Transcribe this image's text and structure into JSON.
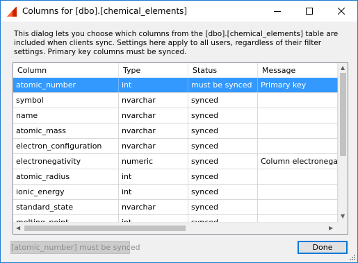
{
  "window": {
    "title": "Columns for [dbo].[chemical_elements]",
    "icon": "app-logo-icon"
  },
  "description": "This dialog lets you choose which columns from the [dbo].[chemical_elements] table are included when clients sync. Settings here apply to all users, regardless of their filter settings. Primary key columns must be synced.",
  "grid": {
    "headers": [
      "Column",
      "Type",
      "Status",
      "Message"
    ],
    "rows": [
      {
        "column": "atomic_number",
        "type": "int",
        "status": "must be synced",
        "message": "Primary key"
      },
      {
        "column": "symbol",
        "type": "nvarchar",
        "status": "synced",
        "message": ""
      },
      {
        "column": "name",
        "type": "nvarchar",
        "status": "synced",
        "message": ""
      },
      {
        "column": "atomic_mass",
        "type": "nvarchar",
        "status": "synced",
        "message": ""
      },
      {
        "column": "electron_configuration",
        "type": "nvarchar",
        "status": "synced",
        "message": ""
      },
      {
        "column": "electronegativity",
        "type": "numeric",
        "status": "synced",
        "message": "Column electronegativity"
      },
      {
        "column": "atomic_radius",
        "type": "int",
        "status": "synced",
        "message": ""
      },
      {
        "column": "ionic_energy",
        "type": "int",
        "status": "synced",
        "message": ""
      },
      {
        "column": "standard_state",
        "type": "nvarchar",
        "status": "synced",
        "message": ""
      },
      {
        "column": "melting_point",
        "type": "int",
        "status": "synced",
        "message": ""
      }
    ],
    "selected_index": 0
  },
  "buttons": {
    "status_label": "[atomic_number] must be synced",
    "done_label": "Done"
  },
  "colors": {
    "selection": "#3399ff",
    "accent": "#0078d7",
    "title_border": "#1f7bd1"
  }
}
